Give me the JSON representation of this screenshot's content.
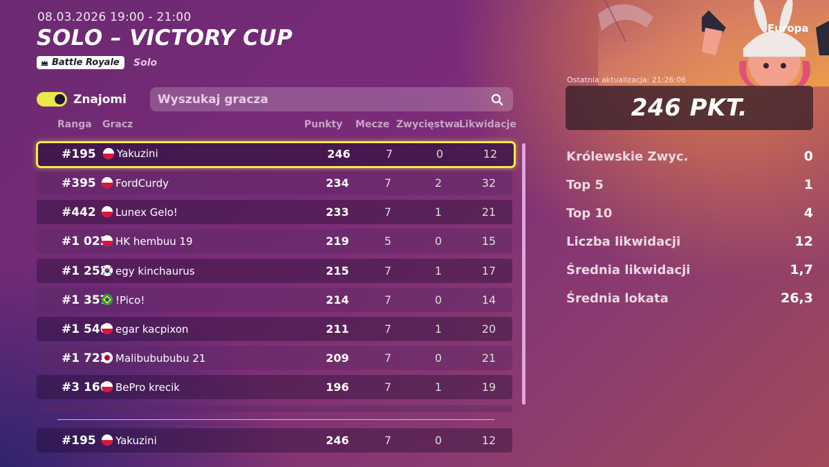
{
  "event": {
    "date": "08.03.2026 19:00 - 21:00",
    "title": "SOLO – VICTORY CUP",
    "mode": "Battle Royale",
    "submode": "Solo"
  },
  "filters": {
    "friends_label": "Znajomi",
    "friends_on": true,
    "search_placeholder": "Wyszukaj gracza"
  },
  "columns": {
    "rank": "Ranga",
    "player": "Gracz",
    "points": "Punkty",
    "matches": "Mecze",
    "wins": "Zwycięstwa",
    "eliminations": "Likwidacje"
  },
  "rows": [
    {
      "rank": "#195",
      "flag": "pl",
      "name": "Yakuzini",
      "points": "246",
      "matches": "7",
      "wins": "0",
      "elims": "12"
    },
    {
      "rank": "#395",
      "flag": "pl",
      "name": "FordCurdy",
      "points": "234",
      "matches": "7",
      "wins": "2",
      "elims": "32"
    },
    {
      "rank": "#442",
      "flag": "pl",
      "name": "Lunex Gelo!",
      "points": "233",
      "matches": "7",
      "wins": "1",
      "elims": "21"
    },
    {
      "rank": "#1 022",
      "flag": "pl",
      "name": "HK hembuu 19",
      "points": "219",
      "matches": "5",
      "wins": "0",
      "elims": "15"
    },
    {
      "rank": "#1 252",
      "flag": "kr",
      "name": "egy kinchaurus",
      "points": "215",
      "matches": "7",
      "wins": "1",
      "elims": "17"
    },
    {
      "rank": "#1 357",
      "flag": "br",
      "name": "!Pico!",
      "points": "214",
      "matches": "7",
      "wins": "0",
      "elims": "14"
    },
    {
      "rank": "#1 546",
      "flag": "pl",
      "name": "egar kacpixon",
      "points": "211",
      "matches": "7",
      "wins": "1",
      "elims": "20"
    },
    {
      "rank": "#1 723",
      "flag": "jp",
      "name": "Malibubububu 21",
      "points": "209",
      "matches": "7",
      "wins": "0",
      "elims": "21"
    },
    {
      "rank": "#3 166",
      "flag": "pl",
      "name": "BePro krecik",
      "points": "196",
      "matches": "7",
      "wins": "1",
      "elims": "19"
    }
  ],
  "me": {
    "rank": "#195",
    "flag": "pl",
    "name": "Yakuzini",
    "points": "246",
    "matches": "7",
    "wins": "0",
    "elims": "12"
  },
  "summary": {
    "region": "Europa",
    "last_update": "Ostatnia aktualizacja: 21:26:06",
    "points": "246 PKT.",
    "stats": [
      {
        "label": "Królewskie Zwyc.",
        "value": "0"
      },
      {
        "label": "Top 5",
        "value": "1"
      },
      {
        "label": "Top 10",
        "value": "4"
      },
      {
        "label": "Liczba likwidacji",
        "value": "12"
      },
      {
        "label": "Średnia likwidacji",
        "value": "1,7"
      },
      {
        "label": "Średnia lokata",
        "value": "26,3"
      }
    ]
  },
  "colors": {
    "highlight": "#f3ec45",
    "toggle": "#ece84a",
    "accent_orange": "#e28a46"
  },
  "icons": {
    "search": "search-icon",
    "mode": "crown-icon"
  }
}
